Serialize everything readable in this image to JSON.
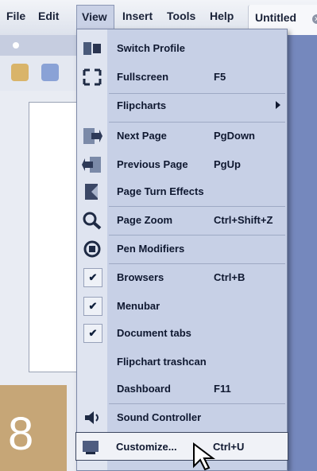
{
  "menubar": {
    "items": [
      "File",
      "Edit",
      "View",
      "Insert",
      "Tools",
      "Help"
    ],
    "doc_tab": "Untitled"
  },
  "badge": "8",
  "menu": {
    "items": [
      {
        "label": "Switch Profile",
        "shortcut": "",
        "icon": "profile-icon"
      },
      {
        "label": "Fullscreen",
        "shortcut": "F5",
        "icon": "fullscreen-icon"
      },
      {
        "label": "Flipcharts",
        "shortcut": "",
        "icon": "",
        "submenu": true
      },
      {
        "label": "Next Page",
        "shortcut": "PgDown",
        "icon": "next-page-icon"
      },
      {
        "label": "Previous Page",
        "shortcut": "PgUp",
        "icon": "previous-page-icon"
      },
      {
        "label": "Page Turn Effects",
        "shortcut": "",
        "icon": "page-turn-icon"
      },
      {
        "label": "Page Zoom",
        "shortcut": "Ctrl+Shift+Z",
        "icon": "zoom-icon"
      },
      {
        "label": "Pen Modifiers",
        "shortcut": "",
        "icon": "pen-modifiers-icon"
      },
      {
        "label": "Browsers",
        "shortcut": "Ctrl+B",
        "checked": true
      },
      {
        "label": "Menubar",
        "shortcut": "",
        "checked": true
      },
      {
        "label": "Document tabs",
        "shortcut": "",
        "checked": true
      },
      {
        "label": "Flipchart trashcan",
        "shortcut": ""
      },
      {
        "label": "Dashboard",
        "shortcut": "F11"
      },
      {
        "label": "Sound Controller",
        "shortcut": "",
        "icon": "sound-icon"
      },
      {
        "label": "Customize...",
        "shortcut": "Ctrl+U",
        "icon": "customize-icon",
        "highlighted": true
      }
    ]
  }
}
